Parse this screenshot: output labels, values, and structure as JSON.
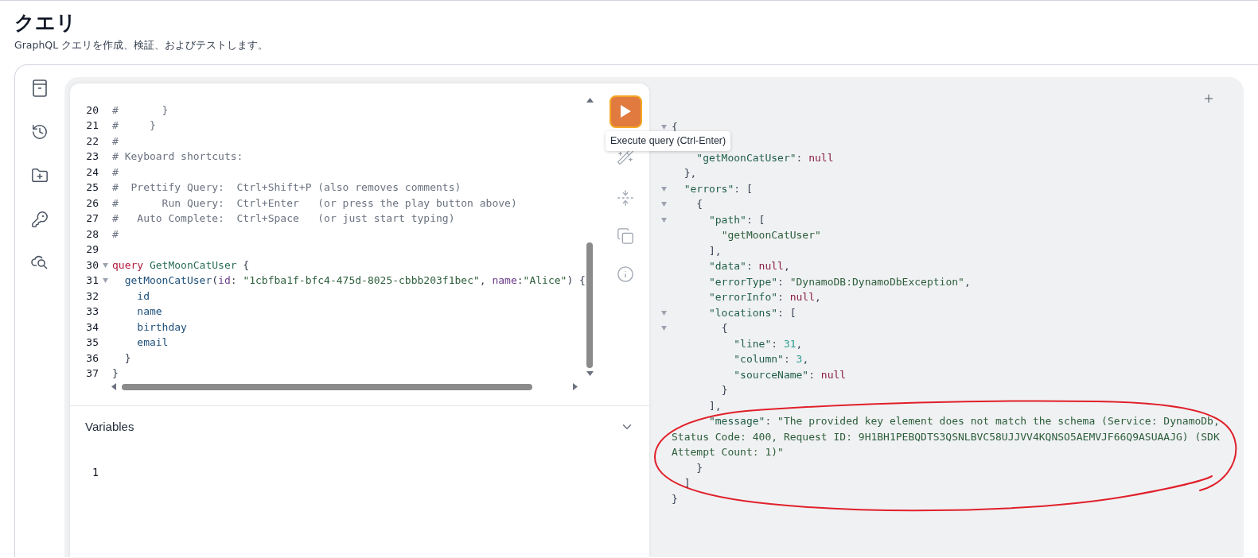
{
  "page": {
    "title": "クエリ",
    "subtitle": "GraphQL クエリを作成、検証、およびテストします。"
  },
  "editor": {
    "lines": [
      {
        "number": "20",
        "foldable": false,
        "tokens": [
          {
            "kind": "comment",
            "text": "#       }"
          }
        ]
      },
      {
        "number": "21",
        "foldable": false,
        "tokens": [
          {
            "kind": "comment",
            "text": "#     }"
          }
        ]
      },
      {
        "number": "22",
        "foldable": false,
        "tokens": [
          {
            "kind": "comment",
            "text": "#"
          }
        ]
      },
      {
        "number": "23",
        "foldable": false,
        "tokens": [
          {
            "kind": "comment",
            "text": "# Keyboard shortcuts:"
          }
        ]
      },
      {
        "number": "24",
        "foldable": false,
        "tokens": [
          {
            "kind": "comment",
            "text": "#"
          }
        ]
      },
      {
        "number": "25",
        "foldable": false,
        "tokens": [
          {
            "kind": "comment",
            "text": "#  Prettify Query:  Ctrl+Shift+P (also removes comments)"
          }
        ]
      },
      {
        "number": "26",
        "foldable": false,
        "tokens": [
          {
            "kind": "comment",
            "text": "#       Run Query:  Ctrl+Enter   (or press the play button above)"
          }
        ]
      },
      {
        "number": "27",
        "foldable": false,
        "tokens": [
          {
            "kind": "comment",
            "text": "#   Auto Complete:  Ctrl+Space   (or just start typing)"
          }
        ]
      },
      {
        "number": "28",
        "foldable": false,
        "tokens": [
          {
            "kind": "comment",
            "text": "#"
          }
        ]
      },
      {
        "number": "29",
        "foldable": false
      },
      {
        "number": "30",
        "foldable": true,
        "tokens": [
          {
            "kind": "keyword",
            "text": "query "
          },
          {
            "kind": "def",
            "text": "GetMoonCatUser"
          },
          {
            "kind": "punct",
            "text": " {"
          }
        ]
      },
      {
        "number": "31",
        "foldable": true,
        "tokens": [
          {
            "kind": "field",
            "text": "  getMoonCatUser"
          },
          {
            "kind": "punct",
            "text": "("
          },
          {
            "kind": "attr",
            "text": "id"
          },
          {
            "kind": "punct",
            "text": ": "
          },
          {
            "kind": "string",
            "text": "\"1cbfba1f-bfc4-475d-8025-cbbb203f1bec\""
          },
          {
            "kind": "punct",
            "text": ", "
          },
          {
            "kind": "attr",
            "text": "name"
          },
          {
            "kind": "punct",
            "text": ":"
          },
          {
            "kind": "string",
            "text": "\"Alice\""
          },
          {
            "kind": "punct",
            "text": ") {"
          }
        ]
      },
      {
        "number": "32",
        "foldable": false,
        "tokens": [
          {
            "kind": "field",
            "text": "    id"
          }
        ]
      },
      {
        "number": "33",
        "foldable": false,
        "tokens": [
          {
            "kind": "field",
            "text": "    name"
          }
        ]
      },
      {
        "number": "34",
        "foldable": false,
        "tokens": [
          {
            "kind": "field",
            "text": "    birthday"
          }
        ]
      },
      {
        "number": "35",
        "foldable": false,
        "tokens": [
          {
            "kind": "field",
            "text": "    email"
          }
        ]
      },
      {
        "number": "36",
        "foldable": false,
        "tokens": [
          {
            "kind": "punct",
            "text": "  }"
          }
        ]
      },
      {
        "number": "37",
        "foldable": false,
        "tokens": [
          {
            "kind": "punct",
            "text": "}"
          }
        ]
      }
    ],
    "tooltip": "Execute query (Ctrl-Enter)",
    "variables": {
      "title": "Variables",
      "line_numbers": [
        "1"
      ]
    }
  },
  "result": {
    "lines": [
      {
        "foldable": true,
        "tokens": [
          {
            "kind": "punct",
            "text": "{"
          }
        ]
      },
      {
        "foldable": false,
        "tokens": [
          {
            "kind": "key",
            "text": "    \"getMoonCatUser\""
          },
          {
            "kind": "punct",
            "text": ": "
          },
          {
            "kind": "null",
            "text": "null"
          }
        ]
      },
      {
        "foldable": false,
        "tokens": [
          {
            "kind": "punct",
            "text": "  },"
          }
        ]
      },
      {
        "foldable": true,
        "tokens": [
          {
            "kind": "key",
            "text": "  \"errors\""
          },
          {
            "kind": "punct",
            "text": ": ["
          }
        ]
      },
      {
        "foldable": true,
        "tokens": [
          {
            "kind": "punct",
            "text": "    {"
          }
        ]
      },
      {
        "foldable": true,
        "tokens": [
          {
            "kind": "key",
            "text": "      \"path\""
          },
          {
            "kind": "punct",
            "text": ": ["
          }
        ]
      },
      {
        "foldable": false,
        "tokens": [
          {
            "kind": "string",
            "text": "        \"getMoonCatUser\""
          }
        ]
      },
      {
        "foldable": false,
        "tokens": [
          {
            "kind": "punct",
            "text": "      ],"
          }
        ]
      },
      {
        "foldable": false,
        "tokens": [
          {
            "kind": "key",
            "text": "      \"data\""
          },
          {
            "kind": "punct",
            "text": ": "
          },
          {
            "kind": "null",
            "text": "null"
          },
          {
            "kind": "punct",
            "text": ","
          }
        ]
      },
      {
        "foldable": false,
        "tokens": [
          {
            "kind": "key",
            "text": "      \"errorType\""
          },
          {
            "kind": "punct",
            "text": ": "
          },
          {
            "kind": "string",
            "text": "\"DynamoDB:DynamoDbException\""
          },
          {
            "kind": "punct",
            "text": ","
          }
        ]
      },
      {
        "foldable": false,
        "tokens": [
          {
            "kind": "key",
            "text": "      \"errorInfo\""
          },
          {
            "kind": "punct",
            "text": ": "
          },
          {
            "kind": "null",
            "text": "null"
          },
          {
            "kind": "punct",
            "text": ","
          }
        ]
      },
      {
        "foldable": true,
        "tokens": [
          {
            "kind": "key",
            "text": "      \"locations\""
          },
          {
            "kind": "punct",
            "text": ": ["
          }
        ]
      },
      {
        "foldable": true,
        "tokens": [
          {
            "kind": "punct",
            "text": "        {"
          }
        ]
      },
      {
        "foldable": false,
        "tokens": [
          {
            "kind": "key",
            "text": "          \"line\""
          },
          {
            "kind": "punct",
            "text": ": "
          },
          {
            "kind": "number",
            "text": "31"
          },
          {
            "kind": "punct",
            "text": ","
          }
        ]
      },
      {
        "foldable": false,
        "tokens": [
          {
            "kind": "key",
            "text": "          \"column\""
          },
          {
            "kind": "punct",
            "text": ": "
          },
          {
            "kind": "number",
            "text": "3"
          },
          {
            "kind": "punct",
            "text": ","
          }
        ]
      },
      {
        "foldable": false,
        "tokens": [
          {
            "kind": "key",
            "text": "          \"sourceName\""
          },
          {
            "kind": "punct",
            "text": ": "
          },
          {
            "kind": "null",
            "text": "null"
          }
        ]
      },
      {
        "foldable": false,
        "tokens": [
          {
            "kind": "punct",
            "text": "        }"
          }
        ]
      },
      {
        "foldable": false,
        "tokens": [
          {
            "kind": "punct",
            "text": "      ],"
          }
        ]
      },
      {
        "foldable": false,
        "tokens": [
          {
            "kind": "key",
            "text": "      \"message\""
          },
          {
            "kind": "punct",
            "text": ": "
          },
          {
            "kind": "string",
            "text": "\"The provided key element does not match the schema (Service: DynamoDb, Status Code: 400, Request ID: 9H1BH1PEBQDTS3QSNLBVC58UJJVV4KQNSO5AEMVJF66Q9ASUAAJG) (SDK Attempt Count: 1)\""
          }
        ]
      },
      {
        "foldable": false,
        "tokens": [
          {
            "kind": "punct",
            "text": "    }"
          }
        ]
      },
      {
        "foldable": false,
        "tokens": [
          {
            "kind": "punct",
            "text": "  ]"
          }
        ]
      },
      {
        "foldable": false,
        "tokens": [
          {
            "kind": "punct",
            "text": "}"
          }
        ]
      }
    ]
  }
}
